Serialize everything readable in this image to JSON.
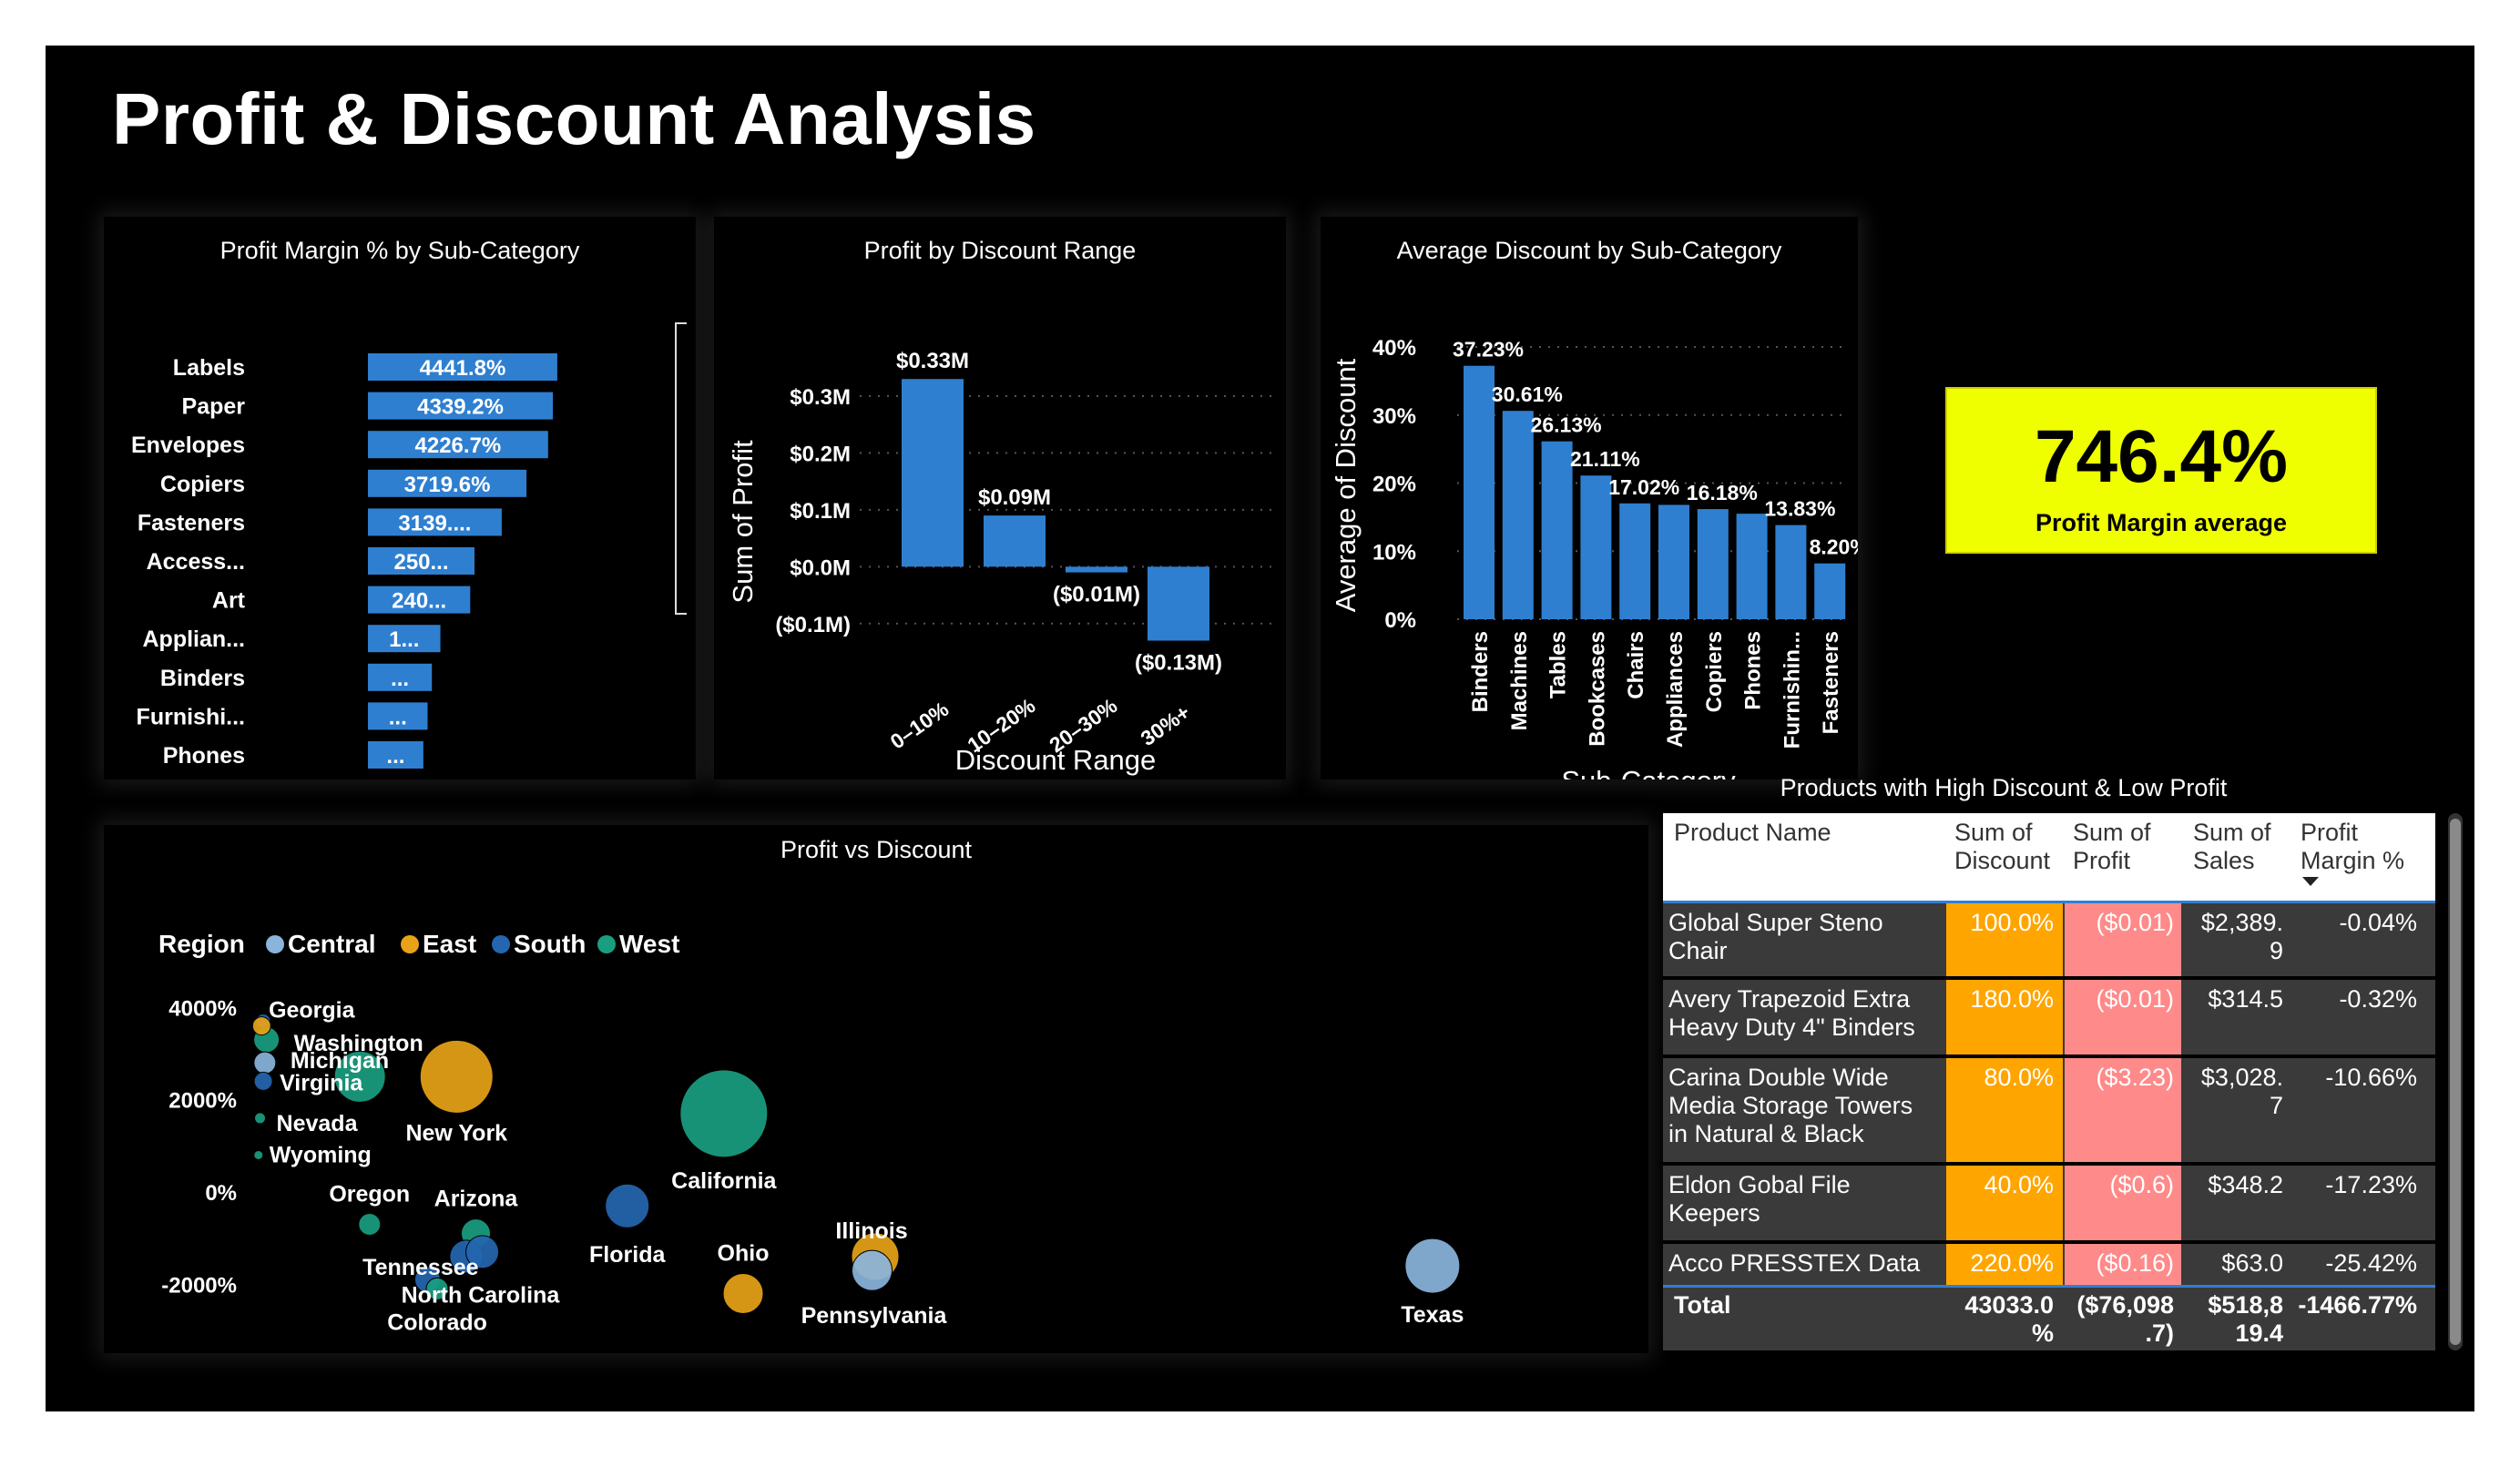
{
  "page": {
    "title": "Profit & Discount Analysis"
  },
  "kpi": {
    "value": "746.4%",
    "label": "Profit Margin average"
  },
  "colors": {
    "bar": "#2f7fd0",
    "central": "#8ab4dc",
    "east": "#e8a317",
    "south": "#2466b0",
    "west": "#1a9e80",
    "kpi_bg": "#f0ff00",
    "discount_cell": "#ffa500",
    "profit_cell": "#ff8a8a"
  },
  "chart_data": [
    {
      "id": "profit-margin-by-subcategory",
      "type": "bar",
      "orientation": "horizontal",
      "title": "Profit Margin % by Sub-Category",
      "categories": [
        "Labels",
        "Paper",
        "Envelopes",
        "Copiers",
        "Fasteners",
        "Access...",
        "Art",
        "Applian...",
        "Binders",
        "Furnishi...",
        "Phones"
      ],
      "values": [
        4441.8,
        4339.2,
        4226.7,
        3719.6,
        3139,
        2500,
        2400,
        1700,
        1500,
        1400,
        1300
      ],
      "data_labels": [
        "4441.8%",
        "4339.2%",
        "4226.7%",
        "3719.6%",
        "3139....",
        "250...",
        "240...",
        "1...",
        "...",
        "...",
        "..."
      ],
      "xticks": [
        "0%",
        "5000%"
      ],
      "xlim": [
        0,
        10000
      ]
    },
    {
      "id": "profit-by-discount-range",
      "type": "bar",
      "title": "Profit by Discount Range",
      "xlabel": "Discount Range",
      "ylabel": "Sum of Profit",
      "categories": [
        "0–10%",
        "10–20%",
        "20–30%",
        "30%+"
      ],
      "values": [
        0.33,
        0.09,
        -0.01,
        -0.13
      ],
      "data_labels": [
        "$0.33M",
        "$0.09M",
        "($0.01M)",
        "($0.13M)"
      ],
      "yticks": [
        "$0.3M",
        "$0.2M",
        "$0.1M",
        "$0.0M",
        "($0.1M)"
      ],
      "ylim": [
        -0.15,
        0.38
      ]
    },
    {
      "id": "average-discount-by-subcategory",
      "type": "bar",
      "title": "Average Discount by Sub-Category",
      "xlabel": "Sub-Category",
      "ylabel": "Average of Discount",
      "categories": [
        "Binders",
        "Machines",
        "Tables",
        "Bookcases",
        "Chairs",
        "Appliances",
        "Copiers",
        "Phones",
        "Furnishin...",
        "Fasteners"
      ],
      "values": [
        37.23,
        30.61,
        26.13,
        21.11,
        17.02,
        16.8,
        16.18,
        15.5,
        13.83,
        8.2
      ],
      "data_labels": [
        "37.23%",
        "30.61%",
        "26.13%",
        "21.11%",
        "17.02%",
        "",
        "16.18%",
        "",
        "13.83%",
        "8.20%"
      ],
      "yticks": [
        "40%",
        "30%",
        "20%",
        "10%",
        "0%"
      ],
      "ylim": [
        0,
        40
      ]
    },
    {
      "id": "profit-vs-discount",
      "type": "scatter",
      "title": "Profit vs Discount",
      "legend": {
        "title": "Region",
        "position": "top-left",
        "items": [
          "Central",
          "East",
          "South",
          "West"
        ]
      },
      "xticks": [
        "0%",
        "10000%",
        "20000%",
        "30000%",
        "40000%"
      ],
      "yticks": [
        "4000%",
        "2000%",
        "0%",
        "-2000%"
      ],
      "xlim": [
        0,
        41000
      ],
      "ylim": [
        -3000,
        4500
      ],
      "points": [
        {
          "label": "Georgia",
          "region": "South",
          "x": 200,
          "y": 3700,
          "size": 8
        },
        {
          "label": "Washington",
          "region": "West",
          "x": 300,
          "y": 3300,
          "size": 14
        },
        {
          "label": "Michigan",
          "region": "Central",
          "x": 250,
          "y": 2800,
          "size": 12
        },
        {
          "label": "Virginia",
          "region": "South",
          "x": 200,
          "y": 2400,
          "size": 10
        },
        {
          "label": "Nevada",
          "region": "West",
          "x": 100,
          "y": 1600,
          "size": 6
        },
        {
          "label": "",
          "region": "East",
          "x": 150,
          "y": 3600,
          "size": 10
        },
        {
          "label": "",
          "region": "West",
          "x": 3200,
          "y": 2500,
          "size": 28
        },
        {
          "label": "New York",
          "region": "East",
          "x": 6200,
          "y": 2500,
          "size": 40
        },
        {
          "label": "Wyoming",
          "region": "West",
          "x": 50,
          "y": 800,
          "size": 5
        },
        {
          "label": "California",
          "region": "West",
          "x": 14500,
          "y": 1700,
          "size": 48
        },
        {
          "label": "Oregon",
          "region": "West",
          "x": 3500,
          "y": -700,
          "size": 12
        },
        {
          "label": "Arizona",
          "region": "West",
          "x": 6800,
          "y": -900,
          "size": 16
        },
        {
          "label": "Tennessee",
          "region": "South",
          "x": 6500,
          "y": -1400,
          "size": 18
        },
        {
          "label": "",
          "region": "South",
          "x": 7000,
          "y": -1300,
          "size": 18
        },
        {
          "label": "North Carolina",
          "region": "South",
          "x": 5300,
          "y": -1900,
          "size": 14
        },
        {
          "label": "Colorado",
          "region": "West",
          "x": 5600,
          "y": -2100,
          "size": 12
        },
        {
          "label": "Florida",
          "region": "South",
          "x": 11500,
          "y": -300,
          "size": 24
        },
        {
          "label": "Illinois",
          "region": "East",
          "x": 19200,
          "y": -1400,
          "size": 26
        },
        {
          "label": "Pennsylvania",
          "region": "Central",
          "x": 19100,
          "y": -1700,
          "size": 22
        },
        {
          "label": "Ohio",
          "region": "East",
          "x": 15100,
          "y": -2200,
          "size": 22
        },
        {
          "label": "Texas",
          "region": "Central",
          "x": 36500,
          "y": -1600,
          "size": 30
        }
      ]
    }
  ],
  "table": {
    "title": "Products with High Discount & Low Profit",
    "headers": [
      {
        "line1": "Product Name",
        "line2": ""
      },
      {
        "line1": "Sum of",
        "line2": "Discount"
      },
      {
        "line1": "Sum of",
        "line2": "Profit"
      },
      {
        "line1": "Sum of",
        "line2": "Sales"
      },
      {
        "line1": "Profit",
        "line2": "Margin %"
      }
    ],
    "rows": [
      {
        "name1": "Global Super Steno",
        "name2": "Chair",
        "name3": "",
        "discount": "100.0%",
        "profit": "($0.01)",
        "sales1": "$2,389.",
        "sales2": "9",
        "margin": "-0.04%"
      },
      {
        "name1": "Avery Trapezoid Extra",
        "name2": "Heavy Duty 4\" Binders",
        "name3": "",
        "discount": "180.0%",
        "profit": "($0.01)",
        "sales1": "$314.5",
        "sales2": "",
        "margin": "-0.32%"
      },
      {
        "name1": "Carina Double Wide",
        "name2": "Media Storage Towers",
        "name3": "in Natural & Black",
        "discount": "80.0%",
        "profit": "($3.23)",
        "sales1": "$3,028.",
        "sales2": "7",
        "margin": "-10.66%"
      },
      {
        "name1": "Eldon Gobal File",
        "name2": "Keepers",
        "name3": "",
        "discount": "40.0%",
        "profit": "($0.6)",
        "sales1": "$348.2",
        "sales2": "",
        "margin": "-17.23%"
      },
      {
        "name1": "Acco PRESSTEX Data",
        "name2": "",
        "name3": "",
        "discount": "220.0%",
        "profit": "($0.16)",
        "sales1": "$63.0",
        "sales2": "",
        "margin": "-25.42%"
      }
    ],
    "total": {
      "label": "Total",
      "discount1": "43033.0",
      "discount2": "%",
      "profit1": "($76,098",
      "profit2": ".7)",
      "sales1": "$518,8",
      "sales2": "19.4",
      "margin": "-1466.77%"
    }
  }
}
